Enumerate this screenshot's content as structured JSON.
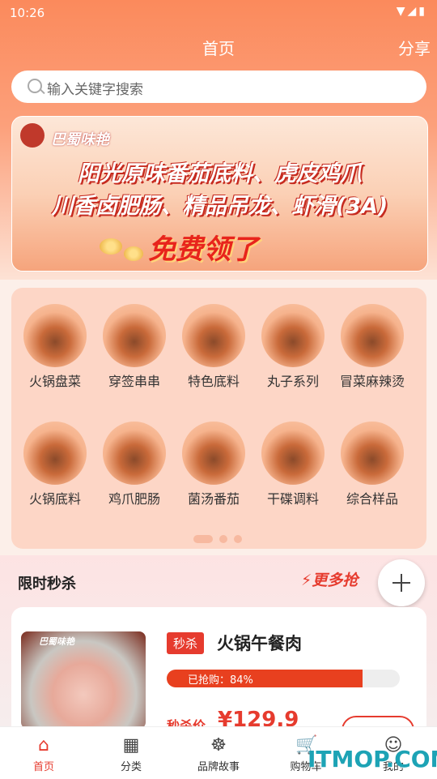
{
  "status": {
    "time": "10:26",
    "icons": "▼◢▮"
  },
  "header": {
    "title": "首页",
    "share": "分享"
  },
  "search": {
    "placeholder": "输入关键字搜索"
  },
  "banner": {
    "brand": "巴蜀味艳",
    "line1": "阳光原味番茄底料、虎皮鸡爪",
    "line2": "川香卤肥肠、精品吊龙、虾滑(3A)",
    "cta": "免费领了"
  },
  "categories": [
    {
      "label": "火锅盘菜",
      "icon": "hotpot-plate-icon"
    },
    {
      "label": "穿签串串",
      "icon": "skewer-icon"
    },
    {
      "label": "特色底料",
      "icon": "soup-base-icon"
    },
    {
      "label": "丸子系列",
      "icon": "meatball-icon"
    },
    {
      "label": "冒菜麻辣烫",
      "icon": "malatang-icon"
    },
    {
      "label": "火锅底料",
      "icon": "hotpot-base-icon"
    },
    {
      "label": "鸡爪肥肠",
      "icon": "chicken-feet-icon"
    },
    {
      "label": "菌汤番茄",
      "icon": "mushroom-soup-icon"
    },
    {
      "label": "干碟调料",
      "icon": "dry-dip-icon"
    },
    {
      "label": "综合样品",
      "icon": "sample-icon"
    }
  ],
  "flash": {
    "title": "限时秒杀",
    "more": "更多抢",
    "product": {
      "brand": "巴蜀味艳",
      "tag": "秒杀",
      "name": "火锅午餐肉",
      "progress_label": "已抢购：84%",
      "progress": 0.84,
      "price_label": "秒杀价",
      "price": "¥129.9"
    }
  },
  "tabs": [
    {
      "label": "首页",
      "icon": "home-icon"
    },
    {
      "label": "分类",
      "icon": "category-grid-icon"
    },
    {
      "label": "品牌故事",
      "icon": "brand-logo-icon"
    },
    {
      "label": "购物车",
      "icon": "cart-icon"
    },
    {
      "label": "我的",
      "icon": "user-icon"
    }
  ],
  "watermark": "ITMOP.COM",
  "colors": {
    "accent": "#e63b2e",
    "header": "#fb8a5c",
    "panel": "#fdd6c6"
  }
}
